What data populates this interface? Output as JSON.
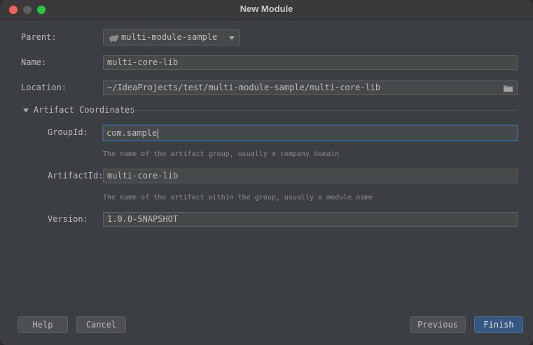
{
  "window": {
    "title": "New Module"
  },
  "form": {
    "parent": {
      "label": "Parent:",
      "value": "multi-module-sample",
      "icon": "maven-module-icon"
    },
    "name": {
      "label": "Name:",
      "value": "multi-core-lib"
    },
    "location": {
      "label": "Location:",
      "value": "~/IdeaProjects/test/multi-module-sample/multi-core-lib",
      "icon": "folder-icon"
    }
  },
  "artifact": {
    "section_title": "Artifact Coordinates",
    "group_id": {
      "label": "GroupId:",
      "value": "com.sample",
      "hint": "The name of the artifact group, usually a company domain"
    },
    "artifact_id": {
      "label": "ArtifactId:",
      "value": "multi-core-lib",
      "hint": "The name of the artifact within the group, usually a module name"
    },
    "version": {
      "label": "Version:",
      "value": "1.0.0-SNAPSHOT"
    }
  },
  "buttons": {
    "help": "Help",
    "cancel": "Cancel",
    "previous": "Previous",
    "finish": "Finish"
  },
  "colors": {
    "accent": "#365880",
    "focus_border": "#3d6185",
    "background": "#3c3f41"
  }
}
